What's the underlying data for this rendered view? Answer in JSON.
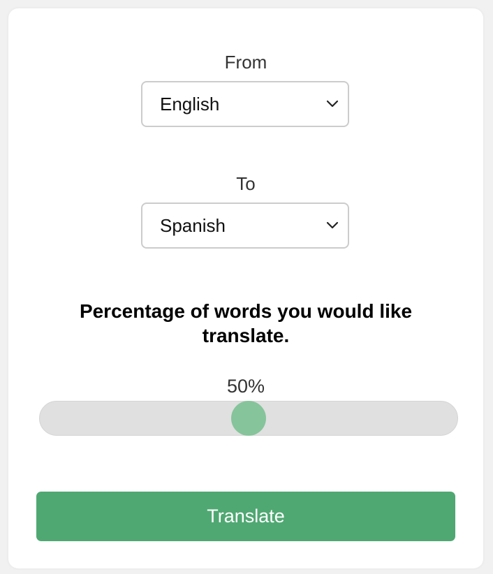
{
  "from": {
    "label": "From",
    "selected": "English",
    "icon": "chevron-down-icon"
  },
  "to": {
    "label": "To",
    "selected": "Spanish",
    "icon": "chevron-down-icon"
  },
  "percentage": {
    "heading": "Percentage of words you would like translate.",
    "value_label": "50%",
    "value": 50,
    "min": 0,
    "max": 100
  },
  "translate_button": {
    "label": "Translate"
  },
  "colors": {
    "accent": "#4fa872",
    "slider_thumb": "#86c49b",
    "slider_track": "#e0e0e0"
  }
}
